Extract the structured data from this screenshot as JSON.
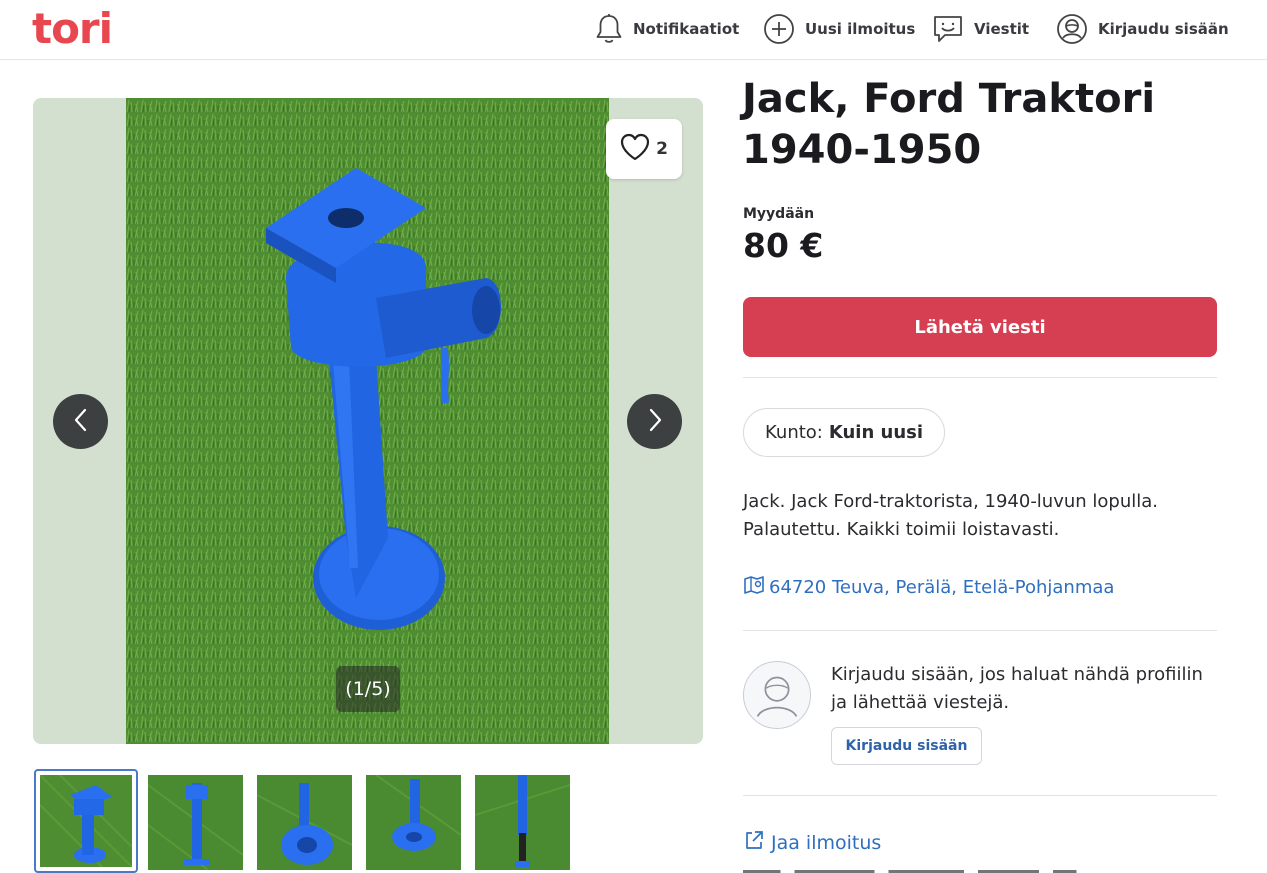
{
  "header": {
    "logo": "tori",
    "nav": {
      "notifications": "Notifikaatiot",
      "new_listing": "Uusi ilmoitus",
      "messages": "Viestit",
      "login": "Kirjaudu sisään"
    }
  },
  "gallery": {
    "favorite_count": "2",
    "counter": "(1/5)",
    "thumbnails": [
      "thumb-1",
      "thumb-2",
      "thumb-3",
      "thumb-4",
      "thumb-5"
    ]
  },
  "listing": {
    "title": "Jack, Ford Traktori 1940-1950",
    "sale_type": "Myydään",
    "price": "80 €",
    "send_message": "Lähetä viesti",
    "condition_label": "Kunto:",
    "condition_value": "Kuin uusi",
    "description": "Jack. Jack Ford-traktorista, 1940-luvun lopulla. Palautettu. Kaikki toimii loistavasti.",
    "location": "64720 Teuva, Perälä, Etelä-Pohjanmaa"
  },
  "seller": {
    "login_prompt": "Kirjaudu sisään, jos haluat nähdä profiilin ja lähettää viestejä.",
    "login_button": "Kirjaudu sisään"
  },
  "share": {
    "label": "Jaa ilmoitus"
  },
  "colors": {
    "brand": "#e8474f",
    "primary_button": "#d63e52",
    "link": "#2f6fc0"
  }
}
